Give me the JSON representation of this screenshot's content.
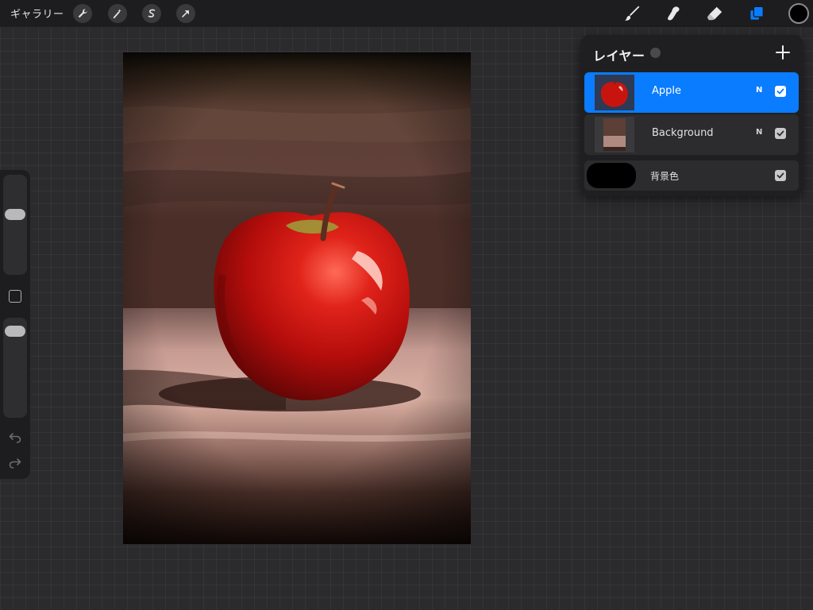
{
  "topbar": {
    "gallery_label": "ギャラリー",
    "left_tools": [
      "wrench-icon",
      "magic-wand-icon",
      "selection-icon",
      "transform-arrow-icon"
    ],
    "right_tools": [
      "brush-icon",
      "smudge-icon",
      "eraser-icon",
      "layers-icon"
    ],
    "active_tool": "layers-icon",
    "current_color": "#000000",
    "accent_color": "#0a7cff"
  },
  "sidebar": {
    "top_slider_label": "brush size",
    "bottom_slider_label": "opacity",
    "undo_icon": "undo-icon",
    "redo_icon": "redo-icon"
  },
  "canvas": {
    "subject": "apple painting"
  },
  "layers_panel": {
    "title": "レイヤー",
    "add_icon": "plus-icon",
    "layers": [
      {
        "name": "Apple",
        "blend_mode": "N",
        "visible": true,
        "selected": true
      },
      {
        "name": "Background",
        "blend_mode": "N",
        "visible": true,
        "selected": false
      }
    ],
    "background_color_label": "背景色",
    "background_color": "#000000",
    "background_visible": true
  }
}
